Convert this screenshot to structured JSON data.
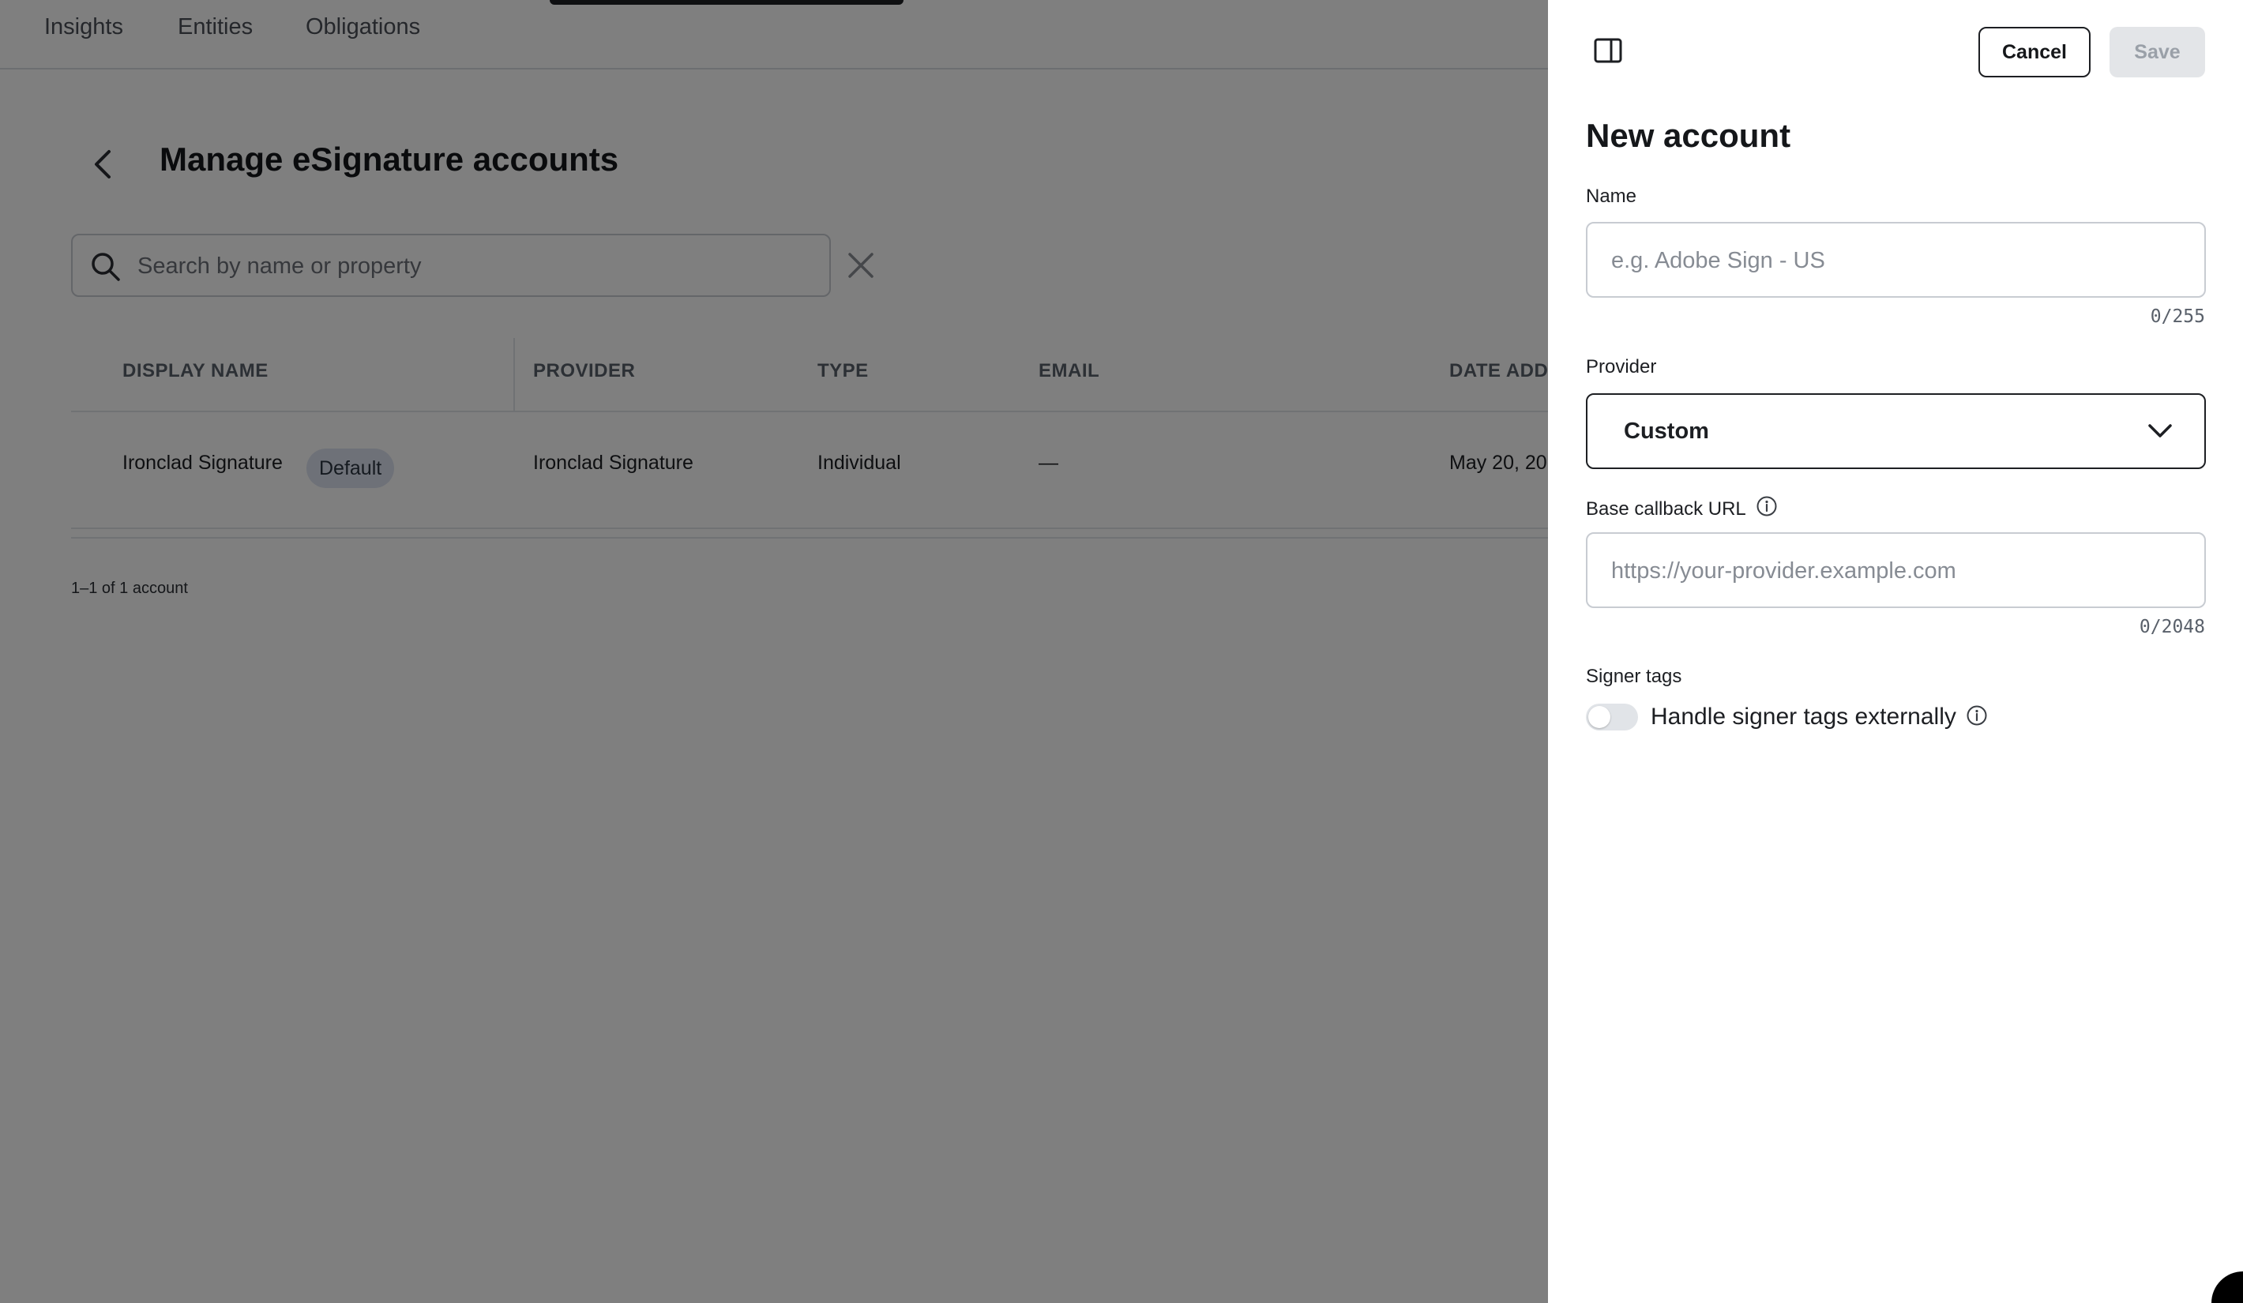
{
  "nav": {
    "tabs": [
      "Insights",
      "Entities",
      "Obligations"
    ]
  },
  "page": {
    "title": "Manage eSignature accounts",
    "search_placeholder": "Search by name or property"
  },
  "table": {
    "columns": [
      "DISPLAY NAME",
      "PROVIDER",
      "TYPE",
      "EMAIL",
      "DATE ADD"
    ],
    "rows": [
      {
        "display_name": "Ironclad Signature",
        "badge": "Default",
        "provider": "Ironclad Signature",
        "type": "Individual",
        "email": "—",
        "date_added": "May 20, 20"
      }
    ],
    "pagination": "1–1 of 1 account"
  },
  "panel": {
    "cancel_label": "Cancel",
    "save_label": "Save",
    "title": "New account",
    "name": {
      "label": "Name",
      "placeholder": "e.g. Adobe Sign - US",
      "value": "",
      "counter": "0/255"
    },
    "provider": {
      "label": "Provider",
      "selected": "Custom"
    },
    "callback": {
      "label": "Base callback URL",
      "placeholder": "https://your-provider.example.com",
      "value": "",
      "counter": "0/2048"
    },
    "signer_tags": {
      "label": "Signer tags",
      "toggle_label": "Handle signer tags externally",
      "enabled": false
    }
  },
  "colors": {
    "overlay": "rgba(0,0,0,0.5)",
    "badge_bg": "#dde3f0",
    "save_disabled_bg": "#e3e5e8",
    "text_primary": "#15171a"
  },
  "icons": [
    "chevron-left-icon",
    "search-icon",
    "close-icon",
    "panel-toggle-icon",
    "chevron-down-icon",
    "info-icon"
  ]
}
